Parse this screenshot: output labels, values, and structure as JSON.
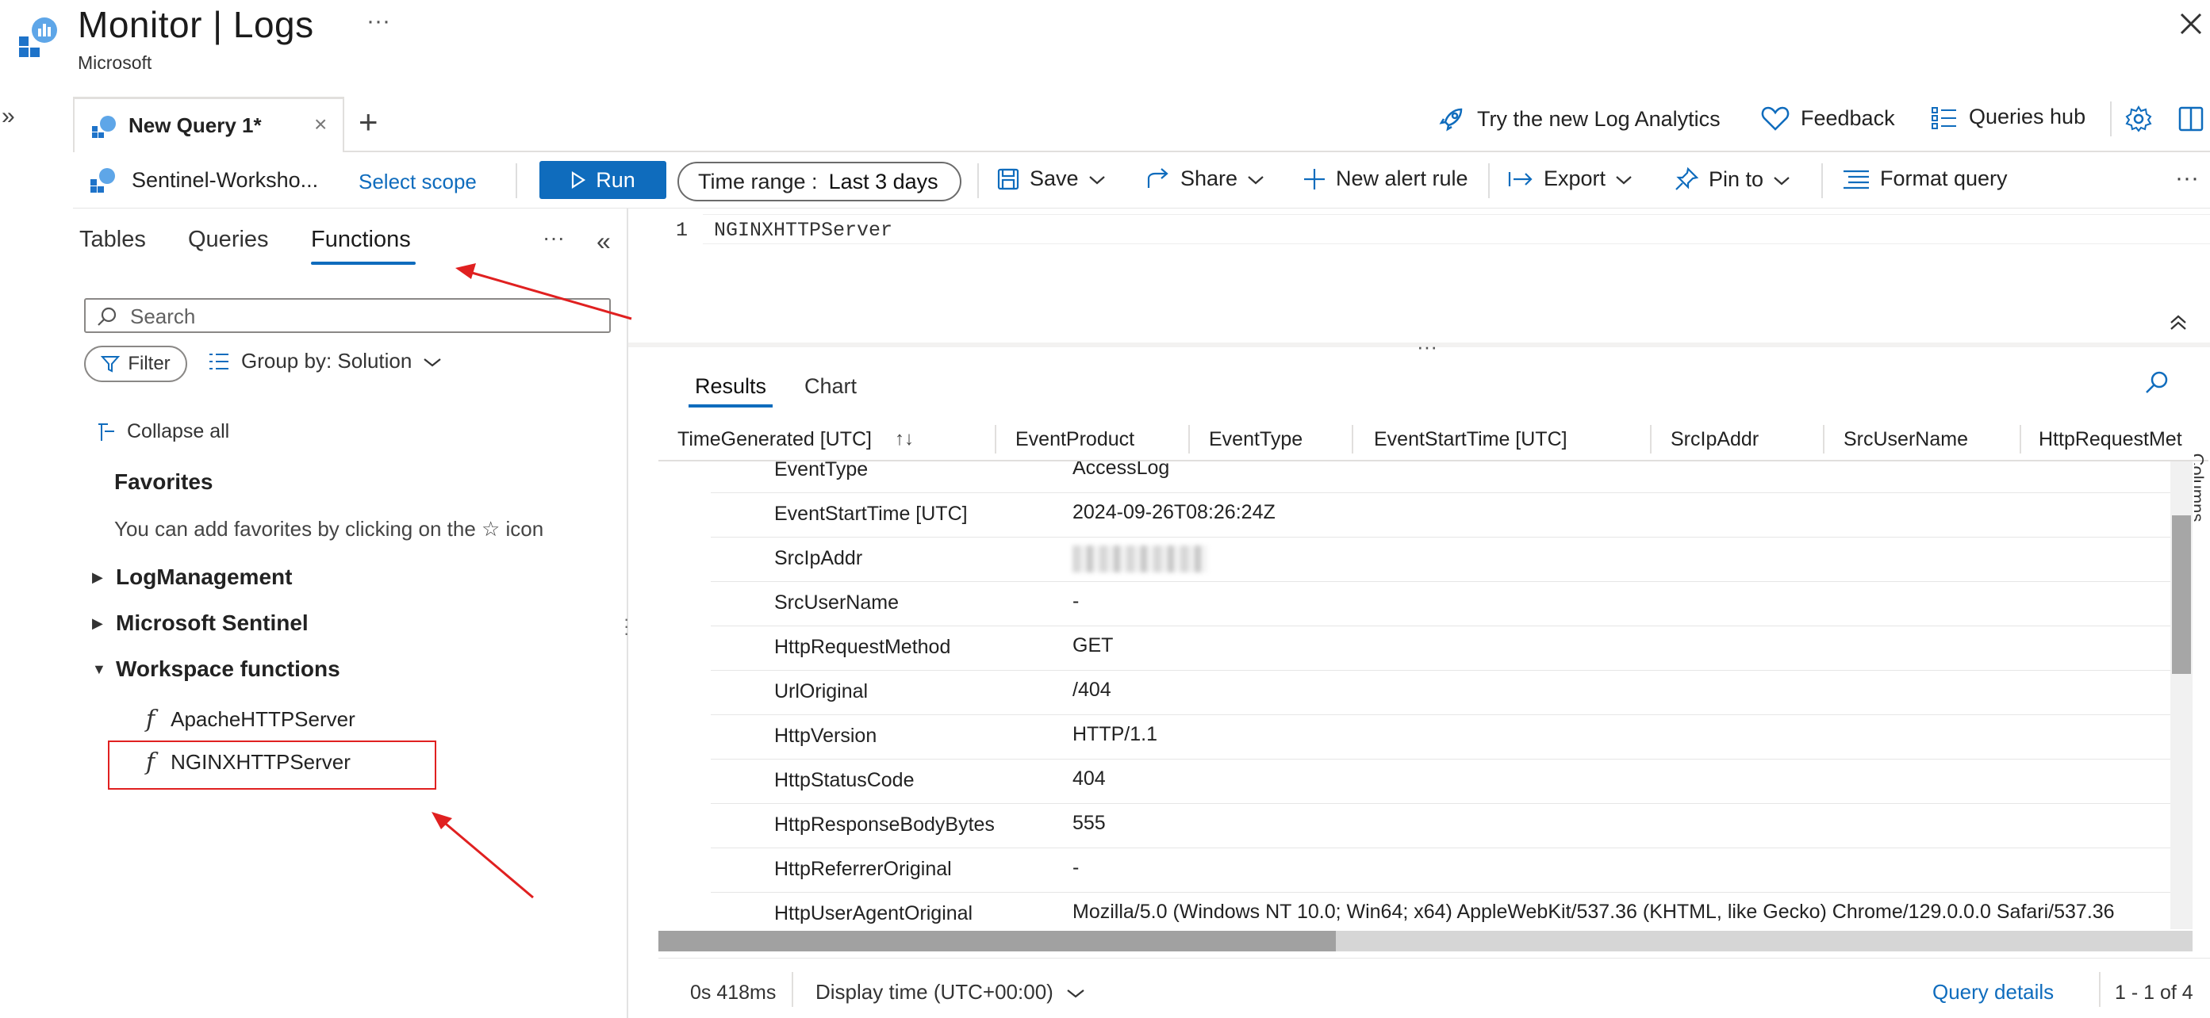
{
  "app": {
    "title": "Monitor | Logs",
    "subtitle": "Microsoft",
    "more": "···"
  },
  "tabs": {
    "query_tab_label": "New Query 1*",
    "query_tab_close": "×",
    "add_tab": "+"
  },
  "top_links": {
    "try_new": "Try the new Log Analytics",
    "feedback": "Feedback",
    "queries_hub": "Queries hub"
  },
  "toolbar": {
    "scope_name": "Sentinel-Worksho...",
    "select_scope": "Select scope",
    "run": "Run",
    "time_range_label": "Time range :",
    "time_range_value": "Last 3 days",
    "save": "Save",
    "share": "Share",
    "new_alert_rule": "New alert rule",
    "export": "Export",
    "pin_to": "Pin to",
    "format_query": "Format query",
    "more": "···"
  },
  "left_pane": {
    "tabs": [
      "Tables",
      "Queries",
      "Functions"
    ],
    "more": "···",
    "search_placeholder": "Search",
    "filter": "Filter",
    "group_by": "Group by: Solution",
    "collapse_all": "Collapse all",
    "favorites_title": "Favorites",
    "favorites_hint": "You can add favorites by clicking on the ☆ icon",
    "tree": [
      "LogManagement",
      "Microsoft Sentinel",
      "Workspace functions"
    ],
    "functions": [
      "ApacheHTTPServer",
      "NGINXHTTPServer"
    ]
  },
  "editor": {
    "line_number": "1",
    "code": "NGINXHTTPServer"
  },
  "results": {
    "tabs": [
      "Results",
      "Chart"
    ],
    "columns": [
      "TimeGenerated [UTC]",
      "EventProduct",
      "EventType",
      "EventStartTime [UTC]",
      "SrcIpAddr",
      "SrcUserName",
      "HttpRequestMet"
    ],
    "columns_panel_label": "Columns",
    "rows": [
      {
        "key": "EventType",
        "value": "AccessLog"
      },
      {
        "key": "EventStartTime [UTC]",
        "value": "2024-09-26T08:26:24Z"
      },
      {
        "key": "SrcIpAddr",
        "value": ""
      },
      {
        "key": "SrcUserName",
        "value": "-"
      },
      {
        "key": "HttpRequestMethod",
        "value": "GET"
      },
      {
        "key": "UrlOriginal",
        "value": "/404"
      },
      {
        "key": "HttpVersion",
        "value": "HTTP/1.1"
      },
      {
        "key": "HttpStatusCode",
        "value": "404"
      },
      {
        "key": "HttpResponseBodyBytes",
        "value": "555"
      },
      {
        "key": "HttpReferrerOriginal",
        "value": "-"
      },
      {
        "key": "HttpUserAgentOriginal",
        "value": "Mozilla/5.0 (Windows NT 10.0; Win64; x64) AppleWebKit/537.36 (KHTML, like Gecko) Chrome/129.0.0.0 Safari/537.36"
      }
    ]
  },
  "status": {
    "elapsed": "0s 418ms",
    "display_time": "Display time (UTC+00:00)",
    "query_details": "Query details",
    "count": "1 - 1 of 4"
  },
  "colors": {
    "accent": "#0f6cbd",
    "annotation": "#e02020"
  }
}
